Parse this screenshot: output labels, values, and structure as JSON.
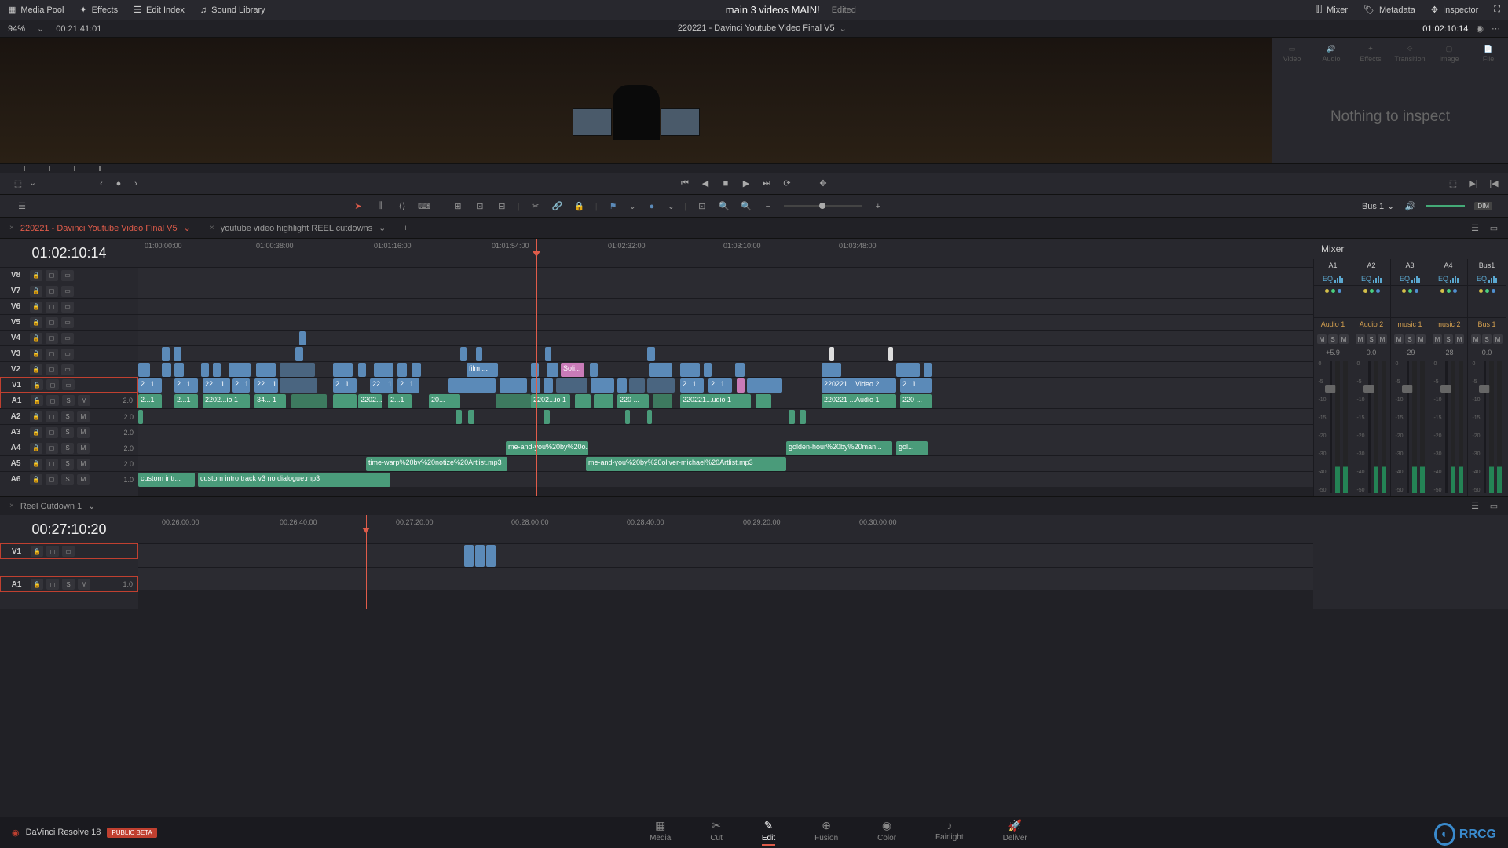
{
  "topbar": {
    "left": [
      {
        "name": "media-pool",
        "label": "Media Pool"
      },
      {
        "name": "effects",
        "label": "Effects"
      },
      {
        "name": "edit-index",
        "label": "Edit Index"
      },
      {
        "name": "sound-library",
        "label": "Sound Library"
      }
    ],
    "project": "main 3 videos MAIN!",
    "status": "Edited",
    "right": [
      {
        "name": "mixer",
        "label": "Mixer"
      },
      {
        "name": "metadata",
        "label": "Metadata"
      },
      {
        "name": "inspector",
        "label": "Inspector"
      }
    ]
  },
  "timecodebar": {
    "zoom": "94%",
    "source_tc": "00:21:41:01",
    "clip_name": "220221 - Davinci Youtube Video Final V5",
    "record_tc": "01:02:10:14"
  },
  "inspector": {
    "tabs": [
      "Video",
      "Audio",
      "Effects",
      "Transition",
      "Image",
      "File"
    ],
    "empty": "Nothing to inspect"
  },
  "edit_toolbar": {
    "bus": "Bus 1",
    "dim": "DIM"
  },
  "timeline_tabs": [
    {
      "label": "220221 - Davinci Youtube Video Final V5",
      "active": true
    },
    {
      "label": "youtube video highlight REEL cutdowns",
      "active": false
    }
  ],
  "main_tc": "01:02:10:14",
  "ruler_labels": [
    "01:00:00:00",
    "01:00:38:00",
    "01:01:16:00",
    "01:01:54:00",
    "01:02:32:00",
    "01:03:10:00",
    "01:03:48:00"
  ],
  "tracks": {
    "video": [
      "V8",
      "V7",
      "V6",
      "V5",
      "V4",
      "V3",
      "V2",
      "V1"
    ],
    "audio": [
      "A1",
      "A2",
      "A3",
      "A4",
      "A5",
      "A6"
    ]
  },
  "audio_level": "2.0",
  "a6_level": "1.0",
  "clips": {
    "v2_label": "film ...",
    "v2_soli": "Soli...",
    "v1_label": "2...1",
    "v1_22": "22... 1",
    "v1_long": "220221 ...Video 2",
    "a1_label": "2...1",
    "a1_22": "2202...io 1",
    "a1_long": "220221 ...Audio 1",
    "a1_220": "220 ...",
    "a1_34": "34... 1",
    "a1_ud": "220221...udio 1",
    "a4": "me-and-you%20by%20o...",
    "a4_2": "golden-hour%20by%20man...",
    "a4_3": "gol...",
    "a5": "time-warp%20by%20notize%20Artlist.mp3",
    "a5_2": "me-and-you%20by%20oliver-michael%20Artlist.mp3",
    "a6_1": "custom intr...",
    "a6_2": "custom intro track v3 no dialogue.mp3"
  },
  "mixer": {
    "title": "Mixer",
    "channels": [
      {
        "id": "A1",
        "eq": "EQ",
        "name": "Audio 1",
        "db": "+5.9"
      },
      {
        "id": "A2",
        "eq": "EQ",
        "name": "Audio 2",
        "db": "0.0"
      },
      {
        "id": "A3",
        "eq": "EQ",
        "name": "music 1",
        "db": "-29"
      },
      {
        "id": "A4",
        "eq": "EQ",
        "name": "music 2",
        "db": "-28"
      },
      {
        "id": "Bus1",
        "eq": "EQ",
        "name": "Bus 1",
        "db": "0.0"
      }
    ],
    "btns": [
      "M",
      "S",
      "M"
    ],
    "scale": [
      "0",
      "-5",
      "-10",
      "-15",
      "-20",
      "-30",
      "-40",
      "-50"
    ]
  },
  "lower": {
    "tab": "Reel Cutdown 1",
    "tc": "00:27:10:20",
    "ruler": [
      "00:26:00:00",
      "00:26:40:00",
      "00:27:20:00",
      "00:28:00:00",
      "00:28:40:00",
      "00:29:20:00",
      "00:30:00:00"
    ],
    "v": "V1",
    "a": "A1",
    "a_level": "1.0"
  },
  "bottom": {
    "app": "DaVinci Resolve 18",
    "badge": "PUBLIC BETA",
    "pages": [
      "Media",
      "Cut",
      "Edit",
      "Fusion",
      "Color",
      "Fairlight",
      "Deliver"
    ],
    "active": "Edit"
  },
  "watermark": "RRCG"
}
